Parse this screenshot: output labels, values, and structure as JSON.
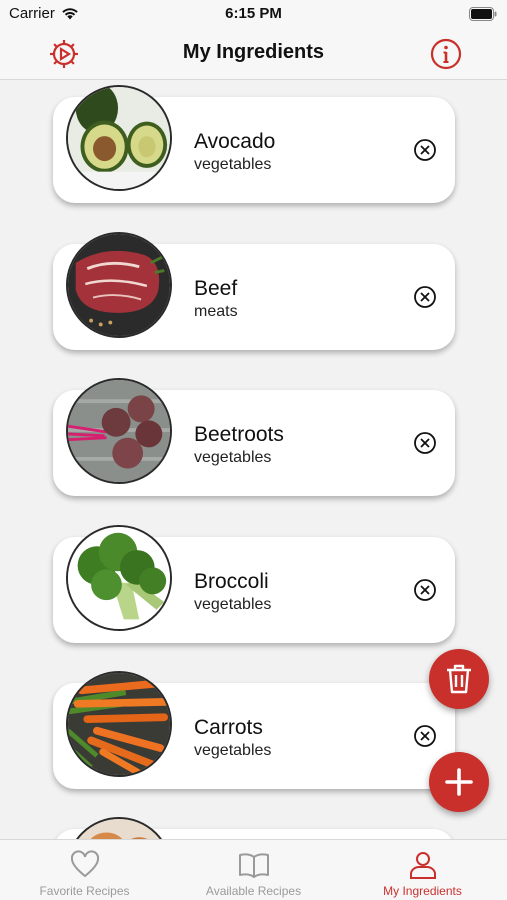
{
  "status_bar": {
    "carrier": "Carrier",
    "time": "6:15 PM"
  },
  "nav": {
    "title": "My Ingredients",
    "left_icon": "gear-icon",
    "right_icon": "info-icon"
  },
  "ingredients": [
    {
      "name": "Avocado",
      "category": "vegetables"
    },
    {
      "name": "Beef",
      "category": "meats"
    },
    {
      "name": "Beetroots",
      "category": "vegetables"
    },
    {
      "name": "Broccoli",
      "category": "vegetables"
    },
    {
      "name": "Carrots",
      "category": "vegetables"
    }
  ],
  "fabs": {
    "delete_icon": "trash-icon",
    "add_icon": "plus-icon"
  },
  "tabs": [
    {
      "label": "Favorite Recipes",
      "icon": "heart-icon",
      "active": false
    },
    {
      "label": "Available Recipes",
      "icon": "book-icon",
      "active": false
    },
    {
      "label": "My Ingredients",
      "icon": "person-icon",
      "active": true
    }
  ],
  "colors": {
    "accent": "#c9302c",
    "background": "#f2f2f2",
    "inactive_tab": "#9a9a9a"
  }
}
